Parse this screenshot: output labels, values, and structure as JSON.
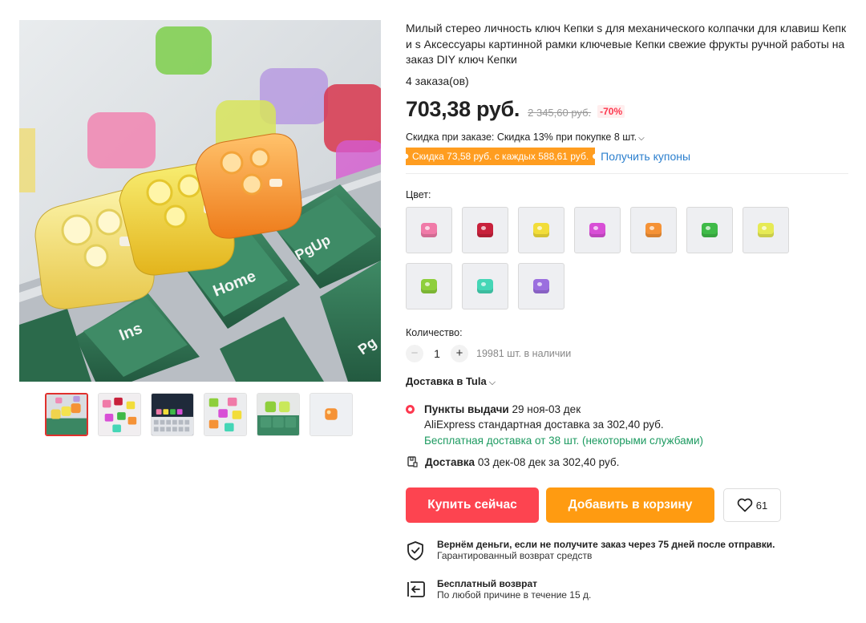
{
  "product": {
    "title": "Милый стерео личность ключ Кепки s для механического колпачки для клавиш Кепки s Аксессуары картинной рамки ключевые Кепки свежие фрукты ручной работы на заказ DIY ключ Кепки",
    "orders": "4 заказа(ов)",
    "price": "703,38 руб.",
    "old_price": "2 345,60 руб.",
    "discount": "-70%",
    "bulk_discount": "Скидка при заказе: Скидка 13% при покупке 8 шт.",
    "coupon_tag": "Скидка 73,58 руб. с каждых 588,61 руб.",
    "coupon_link": "Получить купоны"
  },
  "gallery": {
    "key_labels": {
      "ins": "Ins",
      "home": "Home",
      "pgup": "PgUp",
      "partial": "Pg"
    },
    "thumbnails": [
      "keycaps-keyboard",
      "keycaps-spread",
      "keyboard-dark",
      "keycaps-mix",
      "keycaps-green",
      "keycap-orange"
    ]
  },
  "options": {
    "color_label": "Цвет:",
    "colors": [
      "#f07aa8",
      "#c8213b",
      "#f2dd3a",
      "#d84fd6",
      "#f59236",
      "#3fba48",
      "#e6ea55",
      "#8ecf3c",
      "#45d6b6",
      "#9b6fdf"
    ],
    "quantity_label": "Количество:",
    "quantity_value": "1",
    "minus": "−",
    "plus": "+",
    "stock": "19981 шт. в наличии"
  },
  "shipping": {
    "heading": "Доставка в Tula",
    "pickup_title": "Пункты выдачи",
    "pickup_dates": "29 ноя-03 дек",
    "pickup_line2": "AliExpress стандартная доставка за 302,40 руб.",
    "pickup_line3": "Бесплатная доставка от 38 шт. (некоторыми службами)",
    "courier_title": "Доставка",
    "courier_text": "03 дек-08 дек за 302,40 руб."
  },
  "actions": {
    "buy_now": "Купить сейчас",
    "add_to_cart": "Добавить в корзину",
    "wishlist_count": "61"
  },
  "guarantees": {
    "refund_title": "Вернём деньги, если не получите заказ через 75 дней после отправки.",
    "refund_sub": "Гарантированный возврат средств",
    "return_title": "Бесплатный возврат",
    "return_sub": "По любой причине в течение 15 д."
  },
  "colors": {
    "accent_red": "#fd4450",
    "accent_orange": "#ff9b11",
    "link_blue": "#2b7fce",
    "green": "#1c9a60"
  }
}
